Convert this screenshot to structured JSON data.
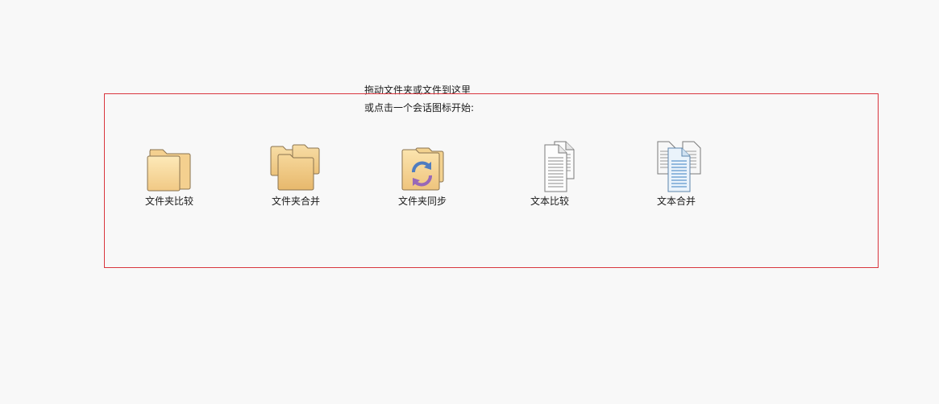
{
  "drop_hint": {
    "line1": "拖动文件夹或文件到这里",
    "line2": "或点击一个会话图标开始:"
  },
  "sessions": [
    {
      "label": "文件夹比较",
      "icon": "folder-compare-icon"
    },
    {
      "label": "文件夹合并",
      "icon": "folder-merge-icon"
    },
    {
      "label": "文件夹同步",
      "icon": "folder-sync-icon"
    },
    {
      "label": "文本比较",
      "icon": "text-compare-icon"
    },
    {
      "label": "文本合并",
      "icon": "text-merge-icon"
    }
  ],
  "colors": {
    "background": "#f8f8f8",
    "drop_zone_border": "#d9363e",
    "folder_light": "#f8dea1",
    "folder_dark": "#e8b567",
    "sync_blue": "#4f7cc0",
    "sync_purple": "#9868b8",
    "doc_lines_gray": "#8a8a8a",
    "doc_lines_blue": "#3a7fc2"
  }
}
